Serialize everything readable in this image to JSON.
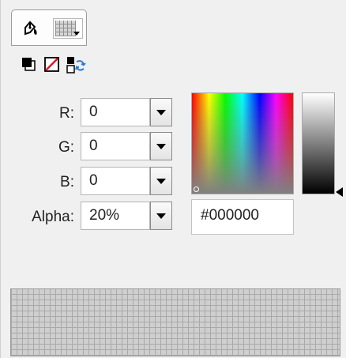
{
  "fields": [
    {
      "label": "R:",
      "value": "0"
    },
    {
      "label": "G:",
      "value": "0"
    },
    {
      "label": "B:",
      "value": "0"
    },
    {
      "label": "Alpha:",
      "value": "20%"
    }
  ],
  "hex": "#000000",
  "icons": {
    "fill_tool": "paint-bucket-icon",
    "swatch_dropdown": "swatch-grid-icon",
    "black_white": "black-white-icon",
    "no_color": "no-color-icon",
    "swap_colors": "swap-colors-icon"
  },
  "colors": {
    "panel_bg": "#f0f0f0",
    "current_color": "#000000"
  }
}
